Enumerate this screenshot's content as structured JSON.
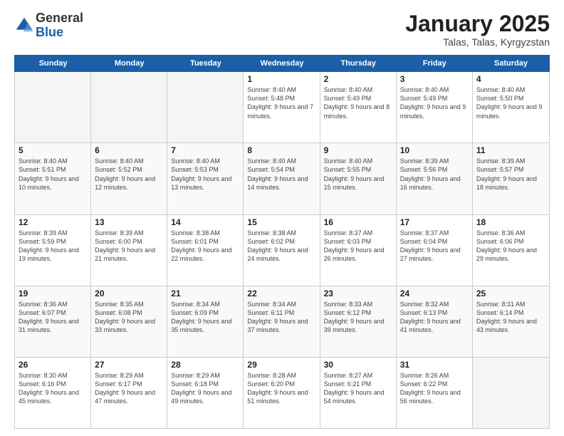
{
  "logo": {
    "general": "General",
    "blue": "Blue"
  },
  "title": "January 2025",
  "location": "Talas, Talas, Kyrgyzstan",
  "days_of_week": [
    "Sunday",
    "Monday",
    "Tuesday",
    "Wednesday",
    "Thursday",
    "Friday",
    "Saturday"
  ],
  "weeks": [
    [
      {
        "day": "",
        "sunrise": "",
        "sunset": "",
        "daylight": "",
        "empty": true
      },
      {
        "day": "",
        "sunrise": "",
        "sunset": "",
        "daylight": "",
        "empty": true
      },
      {
        "day": "",
        "sunrise": "",
        "sunset": "",
        "daylight": "",
        "empty": true
      },
      {
        "day": "1",
        "sunrise": "Sunrise: 8:40 AM",
        "sunset": "Sunset: 5:48 PM",
        "daylight": "Daylight: 9 hours and 7 minutes.",
        "empty": false
      },
      {
        "day": "2",
        "sunrise": "Sunrise: 8:40 AM",
        "sunset": "Sunset: 5:49 PM",
        "daylight": "Daylight: 9 hours and 8 minutes.",
        "empty": false
      },
      {
        "day": "3",
        "sunrise": "Sunrise: 8:40 AM",
        "sunset": "Sunset: 5:49 PM",
        "daylight": "Daylight: 9 hours and 9 minutes.",
        "empty": false
      },
      {
        "day": "4",
        "sunrise": "Sunrise: 8:40 AM",
        "sunset": "Sunset: 5:50 PM",
        "daylight": "Daylight: 9 hours and 9 minutes.",
        "empty": false
      }
    ],
    [
      {
        "day": "5",
        "sunrise": "Sunrise: 8:40 AM",
        "sunset": "Sunset: 5:51 PM",
        "daylight": "Daylight: 9 hours and 10 minutes.",
        "empty": false
      },
      {
        "day": "6",
        "sunrise": "Sunrise: 8:40 AM",
        "sunset": "Sunset: 5:52 PM",
        "daylight": "Daylight: 9 hours and 12 minutes.",
        "empty": false
      },
      {
        "day": "7",
        "sunrise": "Sunrise: 8:40 AM",
        "sunset": "Sunset: 5:53 PM",
        "daylight": "Daylight: 9 hours and 13 minutes.",
        "empty": false
      },
      {
        "day": "8",
        "sunrise": "Sunrise: 8:40 AM",
        "sunset": "Sunset: 5:54 PM",
        "daylight": "Daylight: 9 hours and 14 minutes.",
        "empty": false
      },
      {
        "day": "9",
        "sunrise": "Sunrise: 8:40 AM",
        "sunset": "Sunset: 5:55 PM",
        "daylight": "Daylight: 9 hours and 15 minutes.",
        "empty": false
      },
      {
        "day": "10",
        "sunrise": "Sunrise: 8:39 AM",
        "sunset": "Sunset: 5:56 PM",
        "daylight": "Daylight: 9 hours and 16 minutes.",
        "empty": false
      },
      {
        "day": "11",
        "sunrise": "Sunrise: 8:39 AM",
        "sunset": "Sunset: 5:57 PM",
        "daylight": "Daylight: 9 hours and 18 minutes.",
        "empty": false
      }
    ],
    [
      {
        "day": "12",
        "sunrise": "Sunrise: 8:39 AM",
        "sunset": "Sunset: 5:59 PM",
        "daylight": "Daylight: 9 hours and 19 minutes.",
        "empty": false
      },
      {
        "day": "13",
        "sunrise": "Sunrise: 8:39 AM",
        "sunset": "Sunset: 6:00 PM",
        "daylight": "Daylight: 9 hours and 21 minutes.",
        "empty": false
      },
      {
        "day": "14",
        "sunrise": "Sunrise: 8:38 AM",
        "sunset": "Sunset: 6:01 PM",
        "daylight": "Daylight: 9 hours and 22 minutes.",
        "empty": false
      },
      {
        "day": "15",
        "sunrise": "Sunrise: 8:38 AM",
        "sunset": "Sunset: 6:02 PM",
        "daylight": "Daylight: 9 hours and 24 minutes.",
        "empty": false
      },
      {
        "day": "16",
        "sunrise": "Sunrise: 8:37 AM",
        "sunset": "Sunset: 6:03 PM",
        "daylight": "Daylight: 9 hours and 26 minutes.",
        "empty": false
      },
      {
        "day": "17",
        "sunrise": "Sunrise: 8:37 AM",
        "sunset": "Sunset: 6:04 PM",
        "daylight": "Daylight: 9 hours and 27 minutes.",
        "empty": false
      },
      {
        "day": "18",
        "sunrise": "Sunrise: 8:36 AM",
        "sunset": "Sunset: 6:06 PM",
        "daylight": "Daylight: 9 hours and 29 minutes.",
        "empty": false
      }
    ],
    [
      {
        "day": "19",
        "sunrise": "Sunrise: 8:36 AM",
        "sunset": "Sunset: 6:07 PM",
        "daylight": "Daylight: 9 hours and 31 minutes.",
        "empty": false
      },
      {
        "day": "20",
        "sunrise": "Sunrise: 8:35 AM",
        "sunset": "Sunset: 6:08 PM",
        "daylight": "Daylight: 9 hours and 33 minutes.",
        "empty": false
      },
      {
        "day": "21",
        "sunrise": "Sunrise: 8:34 AM",
        "sunset": "Sunset: 6:09 PM",
        "daylight": "Daylight: 9 hours and 35 minutes.",
        "empty": false
      },
      {
        "day": "22",
        "sunrise": "Sunrise: 8:34 AM",
        "sunset": "Sunset: 6:11 PM",
        "daylight": "Daylight: 9 hours and 37 minutes.",
        "empty": false
      },
      {
        "day": "23",
        "sunrise": "Sunrise: 8:33 AM",
        "sunset": "Sunset: 6:12 PM",
        "daylight": "Daylight: 9 hours and 39 minutes.",
        "empty": false
      },
      {
        "day": "24",
        "sunrise": "Sunrise: 8:32 AM",
        "sunset": "Sunset: 6:13 PM",
        "daylight": "Daylight: 9 hours and 41 minutes.",
        "empty": false
      },
      {
        "day": "25",
        "sunrise": "Sunrise: 8:31 AM",
        "sunset": "Sunset: 6:14 PM",
        "daylight": "Daylight: 9 hours and 43 minutes.",
        "empty": false
      }
    ],
    [
      {
        "day": "26",
        "sunrise": "Sunrise: 8:30 AM",
        "sunset": "Sunset: 6:16 PM",
        "daylight": "Daylight: 9 hours and 45 minutes.",
        "empty": false
      },
      {
        "day": "27",
        "sunrise": "Sunrise: 8:29 AM",
        "sunset": "Sunset: 6:17 PM",
        "daylight": "Daylight: 9 hours and 47 minutes.",
        "empty": false
      },
      {
        "day": "28",
        "sunrise": "Sunrise: 8:29 AM",
        "sunset": "Sunset: 6:18 PM",
        "daylight": "Daylight: 9 hours and 49 minutes.",
        "empty": false
      },
      {
        "day": "29",
        "sunrise": "Sunrise: 8:28 AM",
        "sunset": "Sunset: 6:20 PM",
        "daylight": "Daylight: 9 hours and 51 minutes.",
        "empty": false
      },
      {
        "day": "30",
        "sunrise": "Sunrise: 8:27 AM",
        "sunset": "Sunset: 6:21 PM",
        "daylight": "Daylight: 9 hours and 54 minutes.",
        "empty": false
      },
      {
        "day": "31",
        "sunrise": "Sunrise: 8:26 AM",
        "sunset": "Sunset: 6:22 PM",
        "daylight": "Daylight: 9 hours and 56 minutes.",
        "empty": false
      },
      {
        "day": "",
        "sunrise": "",
        "sunset": "",
        "daylight": "",
        "empty": true
      }
    ]
  ]
}
